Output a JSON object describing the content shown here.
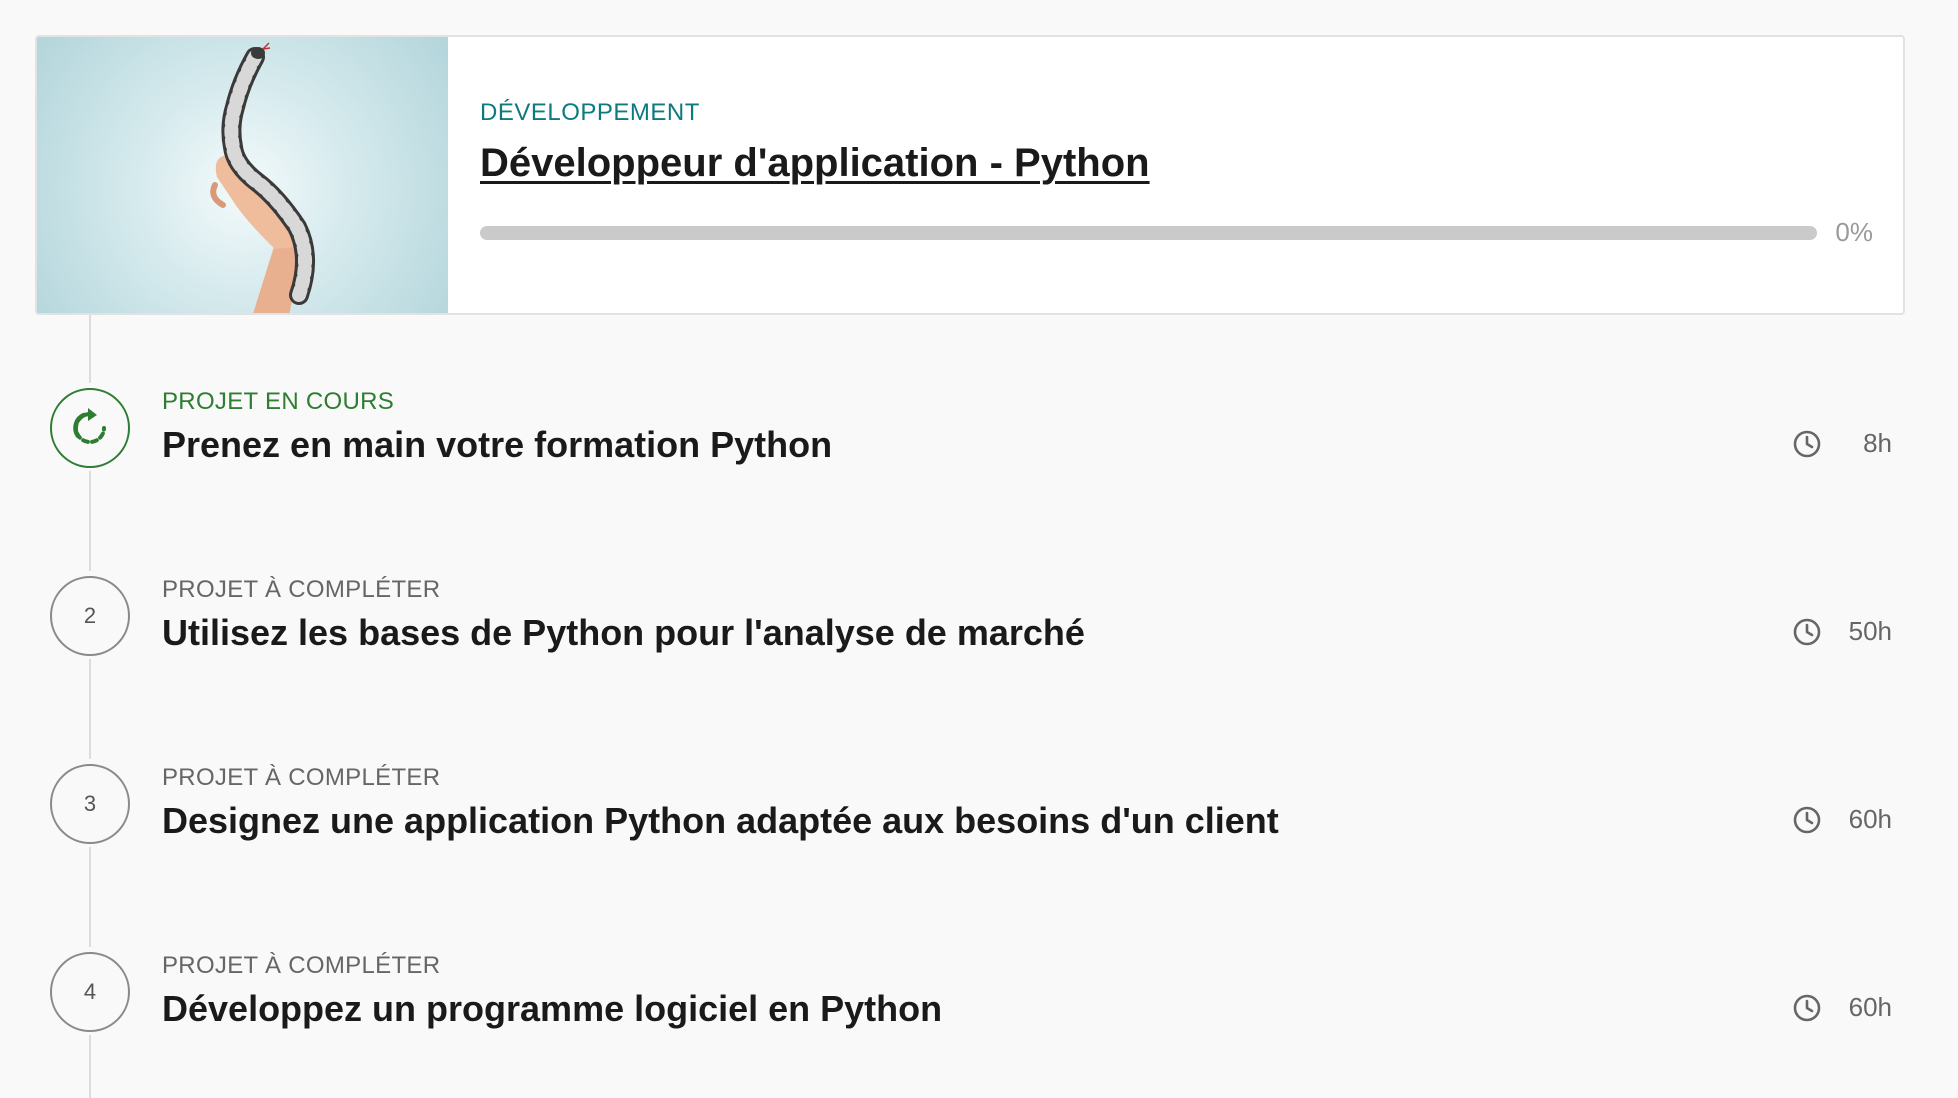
{
  "path": {
    "category": "DÉVELOPPEMENT",
    "title": "Développeur d'application - Python",
    "progress_percent": 0,
    "progress_label": "0%"
  },
  "colors": {
    "accent": "#0e7a80",
    "current": "#2e7d32",
    "track": "#cacaca"
  },
  "projects": [
    {
      "number": "",
      "status": "PROJET EN COURS",
      "title": "Prenez en main votre formation Python",
      "duration": "8h",
      "current": true
    },
    {
      "number": "2",
      "status": "PROJET À COMPLÉTER",
      "title": "Utilisez les bases de Python pour l'analyse de marché",
      "duration": "50h",
      "current": false
    },
    {
      "number": "3",
      "status": "PROJET À COMPLÉTER",
      "title": "Designez une application Python adaptée aux besoins d'un client",
      "duration": "60h",
      "current": false
    },
    {
      "number": "4",
      "status": "PROJET À COMPLÉTER",
      "title": "Développez un programme logiciel en Python",
      "duration": "60h",
      "current": false
    }
  ],
  "icons": {
    "current_step": "refresh-icon",
    "duration": "clock-icon"
  }
}
